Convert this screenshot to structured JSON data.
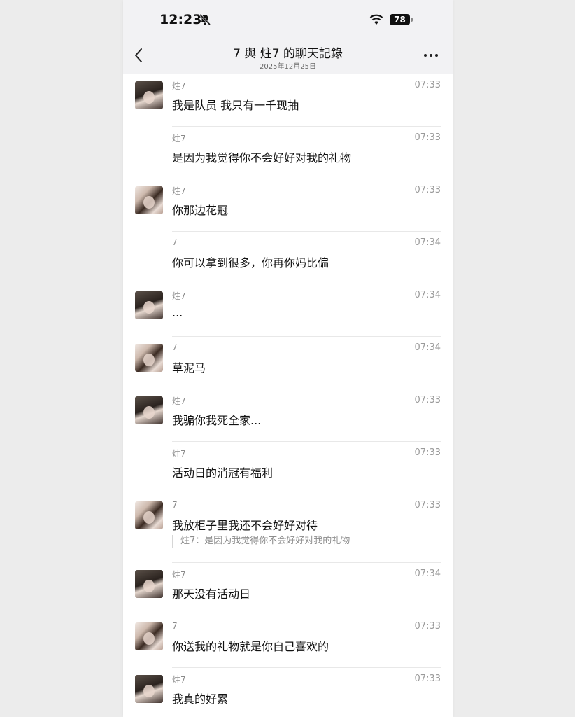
{
  "status_bar": {
    "time": "12:23",
    "battery": "78"
  },
  "header": {
    "title": "7 與 炷7 的聊天記錄",
    "date": "2025年12月25日"
  },
  "messages": [
    {
      "sender": "炷7",
      "time": "07:33",
      "text": "我是队员 我只有一千现抽",
      "avatar": "a",
      "show_avatar": true
    },
    {
      "sender": "炷7",
      "time": "07:33",
      "text": "是因为我觉得你不会好好对我的礼物",
      "avatar": "a",
      "show_avatar": false
    },
    {
      "sender": "炷7",
      "time": "07:33",
      "text": "你那边花冠",
      "avatar": "b",
      "show_avatar": true
    },
    {
      "sender": "7",
      "time": "07:34",
      "text": "你可以拿到很多，你再你妈比偏",
      "avatar": "b",
      "show_avatar": false
    },
    {
      "sender": "炷7",
      "time": "07:34",
      "text": "...",
      "avatar": "a",
      "show_avatar": true
    },
    {
      "sender": "7",
      "time": "07:34",
      "text": "草泥马",
      "avatar": "b",
      "show_avatar": true
    },
    {
      "sender": "炷7",
      "time": "07:33",
      "text": "我骗你我死全家...",
      "avatar": "a",
      "show_avatar": true
    },
    {
      "sender": "炷7",
      "time": "07:33",
      "text": "活动日的消冠有福利",
      "avatar": "a",
      "show_avatar": false
    },
    {
      "sender": "7",
      "time": "07:33",
      "text": "我放柜子里我还不会好好对待",
      "avatar": "b",
      "show_avatar": true,
      "quote": "炷7：是因为我觉得你不会好好对我的礼物"
    },
    {
      "sender": "炷7",
      "time": "07:34",
      "text": "那天没有活动日",
      "avatar": "a",
      "show_avatar": true
    },
    {
      "sender": "7",
      "time": "07:33",
      "text": "你送我的礼物就是你自己喜欢的",
      "avatar": "b",
      "show_avatar": true
    },
    {
      "sender": "炷7",
      "time": "07:33",
      "text": "我真的好累",
      "avatar": "a",
      "show_avatar": true
    }
  ]
}
